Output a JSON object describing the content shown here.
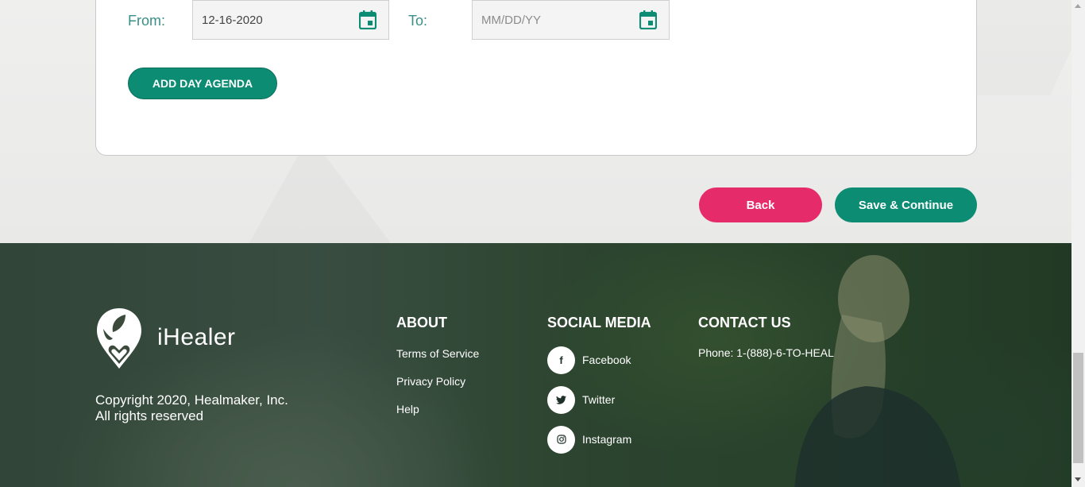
{
  "form": {
    "from_label": "From:",
    "from_value": "12-16-2020",
    "to_label": "To:",
    "to_placeholder": "MM/DD/YY",
    "add_agenda_label": "ADD DAY AGENDA"
  },
  "actions": {
    "back_label": "Back",
    "save_label": "Save & Continue"
  },
  "footer": {
    "brand_name": "iHealer",
    "copyright_line1": "Copyright 2020, Healmaker, Inc.",
    "copyright_line2": "All rights reserved",
    "about": {
      "title": "ABOUT",
      "links": [
        "Terms of Service",
        "Privacy Policy",
        "Help"
      ]
    },
    "social": {
      "title": "SOCIAL MEDIA",
      "items": [
        {
          "label": "Facebook",
          "icon": "facebook-icon"
        },
        {
          "label": "Twitter",
          "icon": "twitter-icon"
        },
        {
          "label": "Instagram",
          "icon": "instagram-icon"
        }
      ]
    },
    "contact": {
      "title": "CONTACT US",
      "phone": "Phone: 1-(888)-6-TO-HEAL"
    }
  },
  "colors": {
    "teal": "#0d8c74",
    "pink": "#e62b6a",
    "label_teal": "#3a8f86"
  }
}
